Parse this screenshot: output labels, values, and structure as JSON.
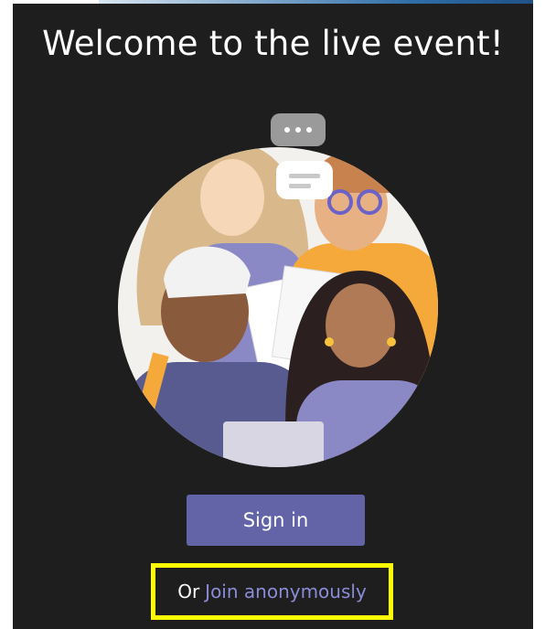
{
  "window": {
    "background": "#1e1e1e",
    "accent": "#6264a7",
    "highlight_border": "#ffff00"
  },
  "header": {
    "title": "Welcome to the live event!"
  },
  "illustration": {
    "icon": "people-group-illustration",
    "chat_bubble_text": "..."
  },
  "actions": {
    "sign_in_label": "Sign in",
    "or_label": "Or",
    "join_anonymously_label": "Join anonymously"
  }
}
